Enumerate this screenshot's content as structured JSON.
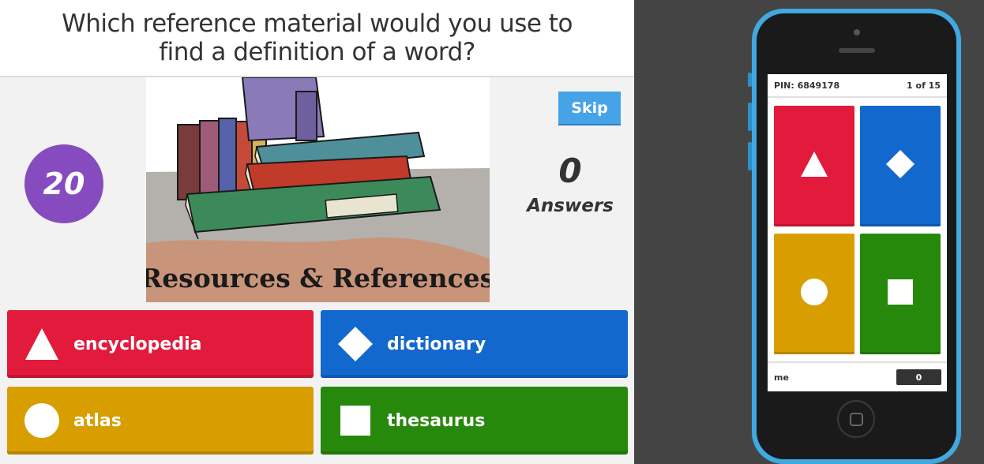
{
  "question": {
    "text": "Which reference material would you use to find a definition of a word?"
  },
  "timer": {
    "value": "20"
  },
  "media": {
    "caption": "Resources & References"
  },
  "skip": {
    "label": "Skip"
  },
  "answers_counter": {
    "count": "0",
    "label": "Answers"
  },
  "answers": [
    {
      "shape": "triangle-icon",
      "label": "encyclopedia",
      "color": "#e21b3c"
    },
    {
      "shape": "diamond-icon",
      "label": "dictionary",
      "color": "#1368ce"
    },
    {
      "shape": "circle-icon",
      "label": "atlas",
      "color": "#d89e00"
    },
    {
      "shape": "square-icon",
      "label": "thesaurus",
      "color": "#26890c"
    }
  ],
  "phone": {
    "pin": "PIN: 6849178",
    "progress": "1 of 15",
    "nickname": "me",
    "score": "0",
    "frame_color": "#3fa9e0"
  }
}
